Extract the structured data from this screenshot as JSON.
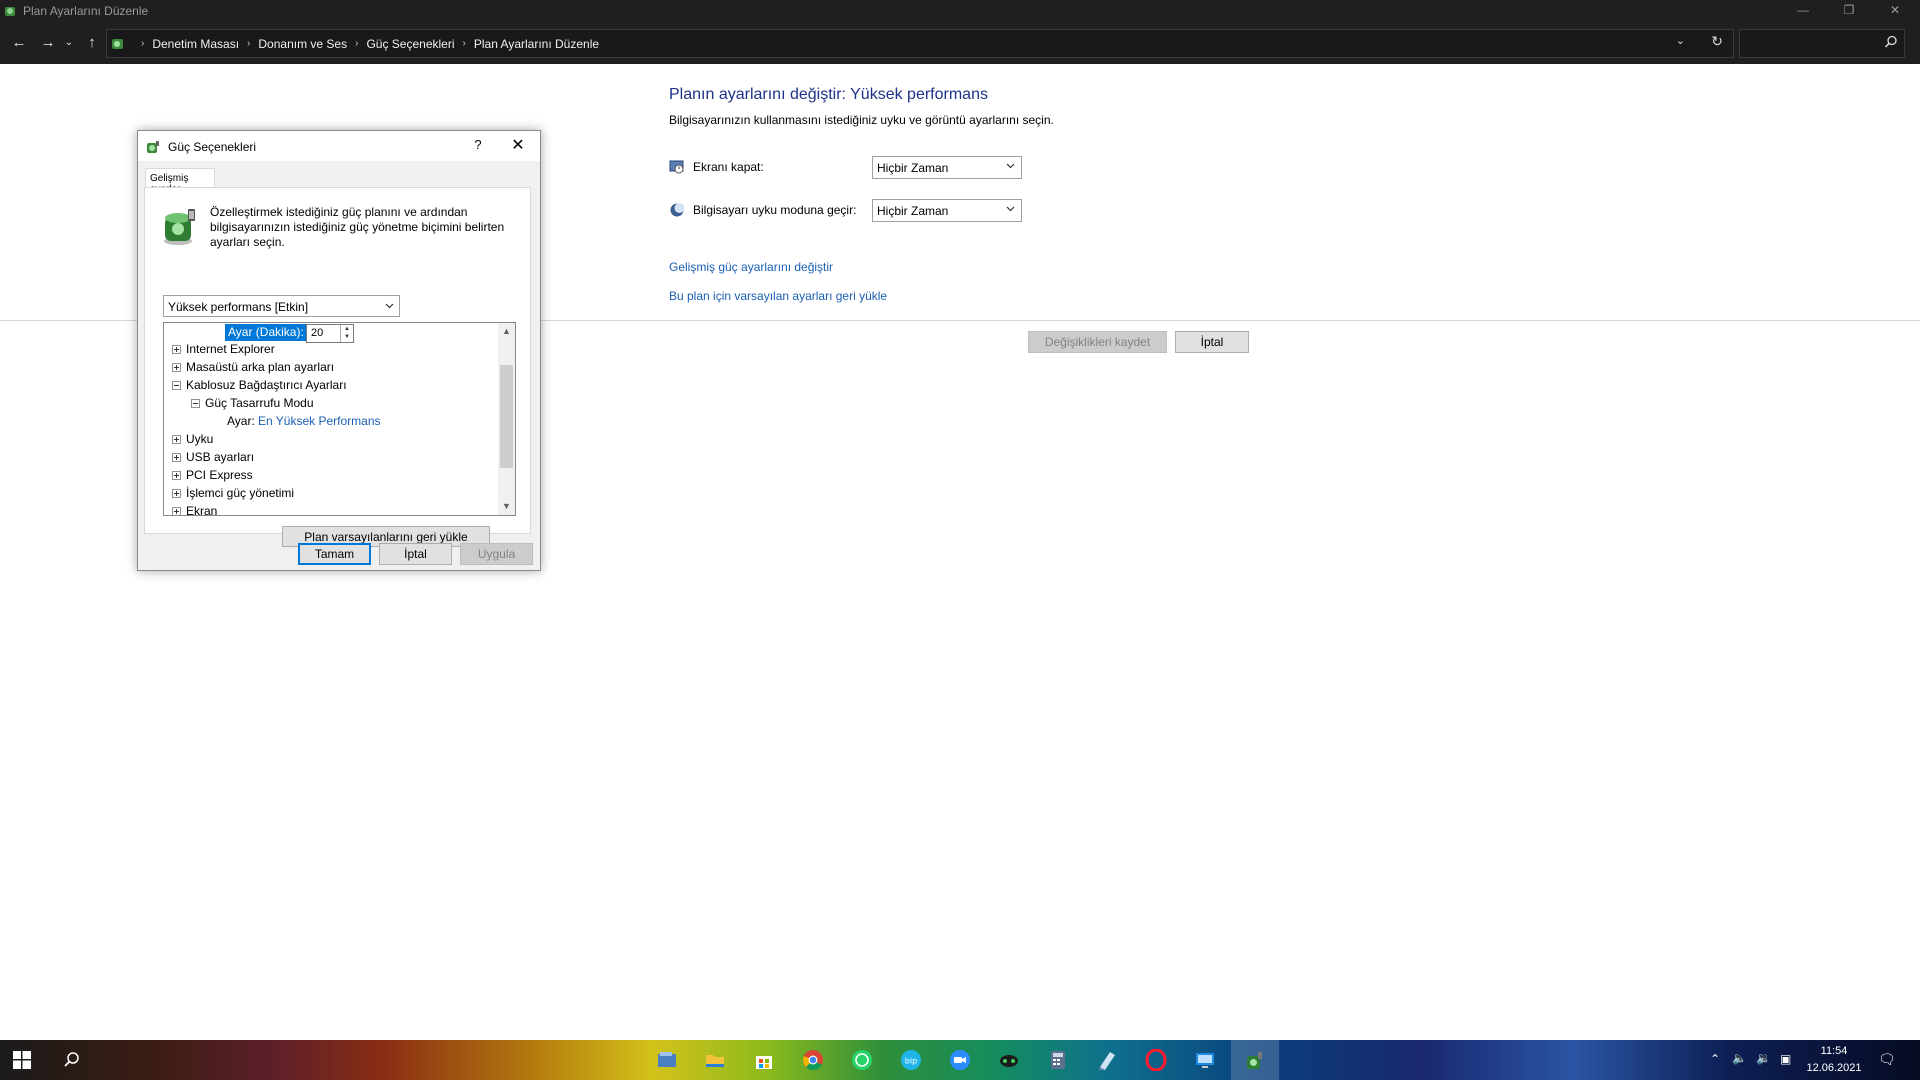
{
  "window": {
    "title": "Plan Ayarlarını Düzenle",
    "minimize_icon": "minimize-icon",
    "maximize_icon": "restore-icon",
    "close_icon": "close-icon"
  },
  "address_bar": {
    "breadcrumbs": [
      "Denetim Masası",
      "Donanım ve Ses",
      "Güç Seçenekleri",
      "Plan Ayarlarını Düzenle"
    ],
    "search_placeholder": ""
  },
  "main": {
    "heading": "Planın ayarlarını değiştir: Yüksek performans",
    "subtitle": "Bilgisayarınızın kullanmasını istediğiniz uyku ve görüntü ayarlarını seçin.",
    "display_off": {
      "label": "Ekranı kapat:",
      "value": "Hiçbir Zaman"
    },
    "sleep": {
      "label": "Bilgisayarı uyku moduna geçir:",
      "value": "Hiçbir Zaman"
    },
    "link_advanced": "Gelişmiş güç ayarlarını değiştir",
    "link_restore": "Bu plan için varsayılan ayarları geri yükle",
    "save_button": "Değişiklikleri kaydet",
    "cancel_button": "İptal"
  },
  "dialog": {
    "title": "Güç Seçenekleri",
    "help": "?",
    "close": "✕",
    "tab": "Gelişmiş ayarlar",
    "description": "Özelleştirmek istediğiniz güç planını ve ardından bilgisayarınızın istediğiniz güç yönetme biçimini belirten ayarları seçin.",
    "plan_select": "Yüksek performans [Etkin]",
    "tree": {
      "setting_label": "Ayar (Dakika):",
      "setting_value": "20",
      "items": [
        {
          "label": "Internet Explorer",
          "state": "collapsed"
        },
        {
          "label": "Masaüstü arka plan ayarları",
          "state": "collapsed"
        },
        {
          "label": "Kablosuz Bağdaştırıcı Ayarları",
          "state": "expanded"
        },
        {
          "label": "Güç Tasarrufu Modu",
          "state": "expanded"
        },
        {
          "label": "Uyku",
          "state": "collapsed"
        },
        {
          "label": "USB ayarları",
          "state": "collapsed"
        },
        {
          "label": "PCI Express",
          "state": "collapsed"
        },
        {
          "label": "İşlemci güç yönetimi",
          "state": "collapsed"
        },
        {
          "label": "Ekran",
          "state": "collapsed"
        }
      ],
      "sub_setting_label": "Ayar:",
      "sub_setting_value": "En Yüksek Performans"
    },
    "restore_button": "Plan varsayılanlarını geri yükle",
    "ok_button": "Tamam",
    "cancel_button": "İptal",
    "apply_button": "Uygula"
  },
  "taskbar": {
    "icons": [
      "windows-start-icon",
      "search-icon",
      "file-explorer-icon",
      "folder-icon",
      "store-icon",
      "chrome-icon",
      "whatsapp-icon",
      "bip-icon",
      "zoom-icon",
      "game-icon",
      "calculator-icon",
      "notepad-icon",
      "opera-icon",
      "monitor-app-icon",
      "power-options-icon"
    ],
    "time": "11:54",
    "date": "12.06.2021"
  },
  "colors": {
    "heading": "#1e3287",
    "link": "#1a5fb4",
    "selection": "#0078d7",
    "titlebar": "#1f1f1f"
  }
}
